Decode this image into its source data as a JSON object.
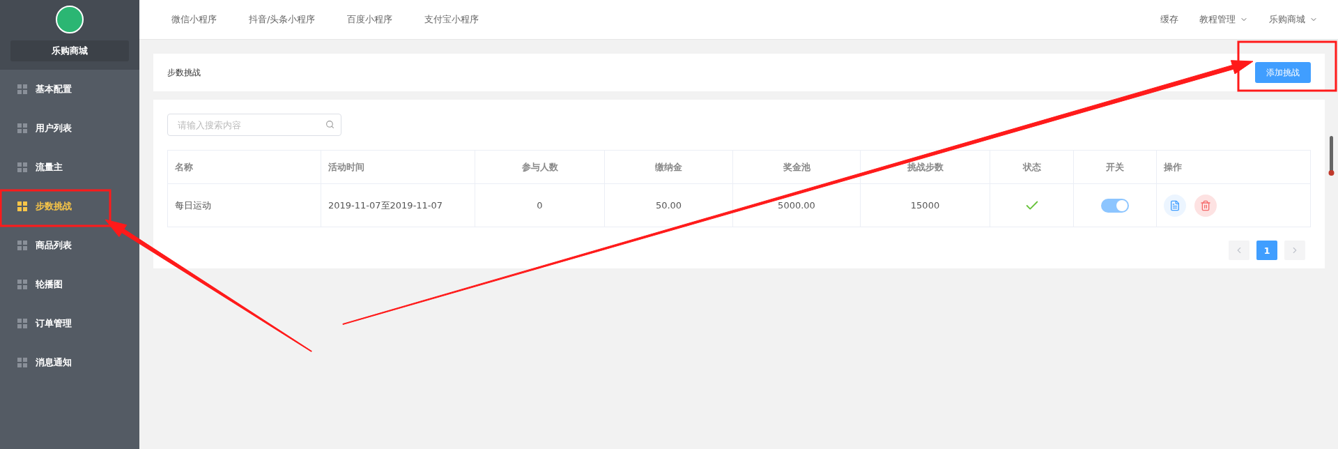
{
  "sidebar": {
    "brand": "乐购商城",
    "items": [
      {
        "label": "基本配置",
        "selected": false
      },
      {
        "label": "用户列表",
        "selected": false
      },
      {
        "label": "流量主",
        "selected": false
      },
      {
        "label": "步数挑战",
        "selected": true
      },
      {
        "label": "商品列表",
        "selected": false
      },
      {
        "label": "轮播图",
        "selected": false
      },
      {
        "label": "订单管理",
        "selected": false
      },
      {
        "label": "消息通知",
        "selected": false
      }
    ]
  },
  "topnav": {
    "tabs": [
      "微信小程序",
      "抖音/头条小程序",
      "百度小程序",
      "支付宝小程序"
    ],
    "right": [
      {
        "label": "缓存",
        "dropdown": false
      },
      {
        "label": "教程管理",
        "dropdown": true
      },
      {
        "label": "乐购商城",
        "dropdown": true
      }
    ]
  },
  "page": {
    "title": "步数挑战",
    "add_button": "添加挑战"
  },
  "search": {
    "placeholder": "请输入搜索内容"
  },
  "table": {
    "columns": [
      {
        "label": "名称"
      },
      {
        "label": "活动时间"
      },
      {
        "label": "参与人数"
      },
      {
        "label": "缴纳金"
      },
      {
        "label": "奖金池"
      },
      {
        "label": "挑战步数"
      },
      {
        "label": "状态"
      },
      {
        "label": "开关"
      },
      {
        "label": "操作"
      }
    ],
    "rows": [
      {
        "cells": [
          "每日运动",
          "2019-11-07至2019-11-07",
          "0",
          "50.00",
          "5000.00",
          "15000"
        ],
        "status": true,
        "on": true
      }
    ]
  },
  "pagination": {
    "pages": [
      {
        "label": "1",
        "selected": true
      }
    ]
  }
}
